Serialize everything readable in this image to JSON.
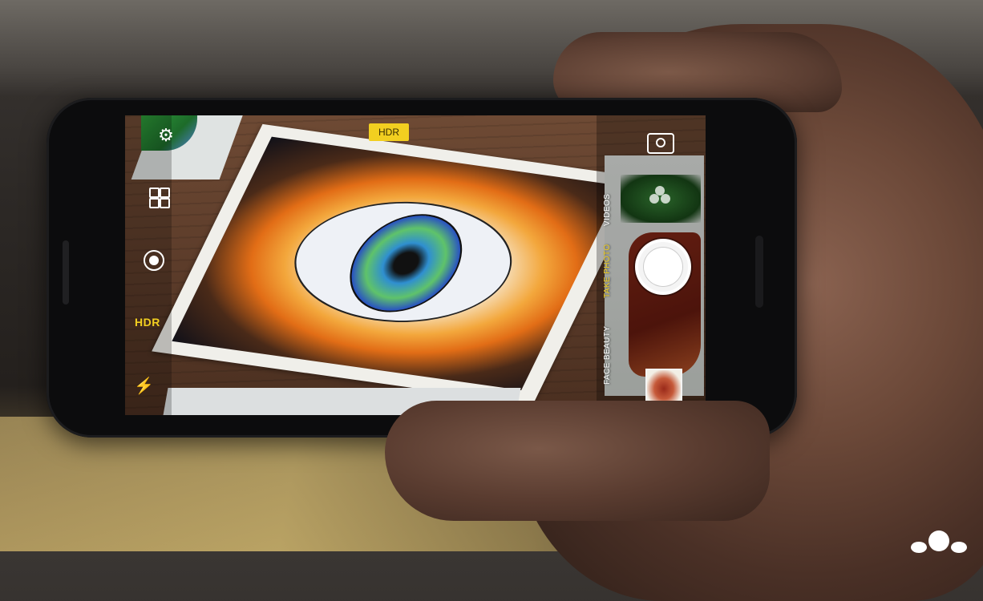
{
  "camera_ui": {
    "hdr_badge": "HDR",
    "hdr_side_label": "HDR",
    "modes": [
      {
        "label": "VIDEOS",
        "active": false
      },
      {
        "label": "TAKE PHOTO",
        "active": true
      },
      {
        "label": "FACE BEAUTY",
        "active": false
      }
    ],
    "icons": {
      "settings": "gear-icon",
      "grid": "grid-icon",
      "record": "live-record-icon",
      "flash": "flash-off-icon",
      "switch_camera": "switch-camera-icon",
      "filters": "filters-icon",
      "shutter": "shutter-button",
      "gallery": "gallery-thumbnail"
    },
    "colors": {
      "accent": "#f2cf20",
      "ui_text": "#ffffff"
    }
  }
}
